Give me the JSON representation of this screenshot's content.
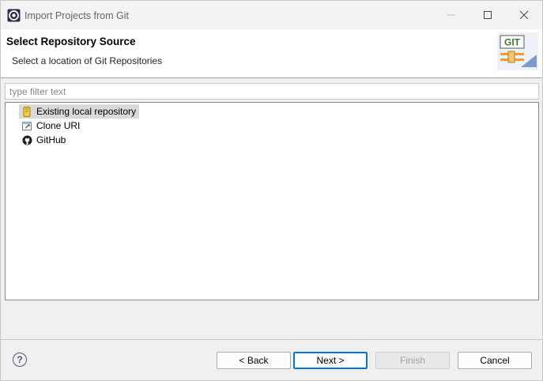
{
  "window": {
    "title": "Import Projects from Git",
    "controls": {
      "minimize": "minimize-icon",
      "maximize": "maximize-icon",
      "close": "close-icon"
    }
  },
  "banner": {
    "title": "Select Repository Source",
    "description": "Select a location of Git Repositories",
    "logo_text": "GIT"
  },
  "filter": {
    "placeholder": "type filter text",
    "value": ""
  },
  "tree": {
    "items": [
      {
        "label": "Existing local repository",
        "icon": "repository-icon",
        "selected": true
      },
      {
        "label": "Clone URI",
        "icon": "clone-uri-icon",
        "selected": false
      },
      {
        "label": "GitHub",
        "icon": "github-icon",
        "selected": false
      }
    ]
  },
  "footer": {
    "help_icon": "help-icon",
    "back_label": "< Back",
    "next_label": "Next >",
    "finish_label": "Finish",
    "cancel_label": "Cancel",
    "finish_enabled": false
  },
  "colors": {
    "accent": "#0078d7",
    "selection": "#d9d9d9",
    "git_green": "#3c7a2c",
    "git_orange": "#f0a030"
  }
}
